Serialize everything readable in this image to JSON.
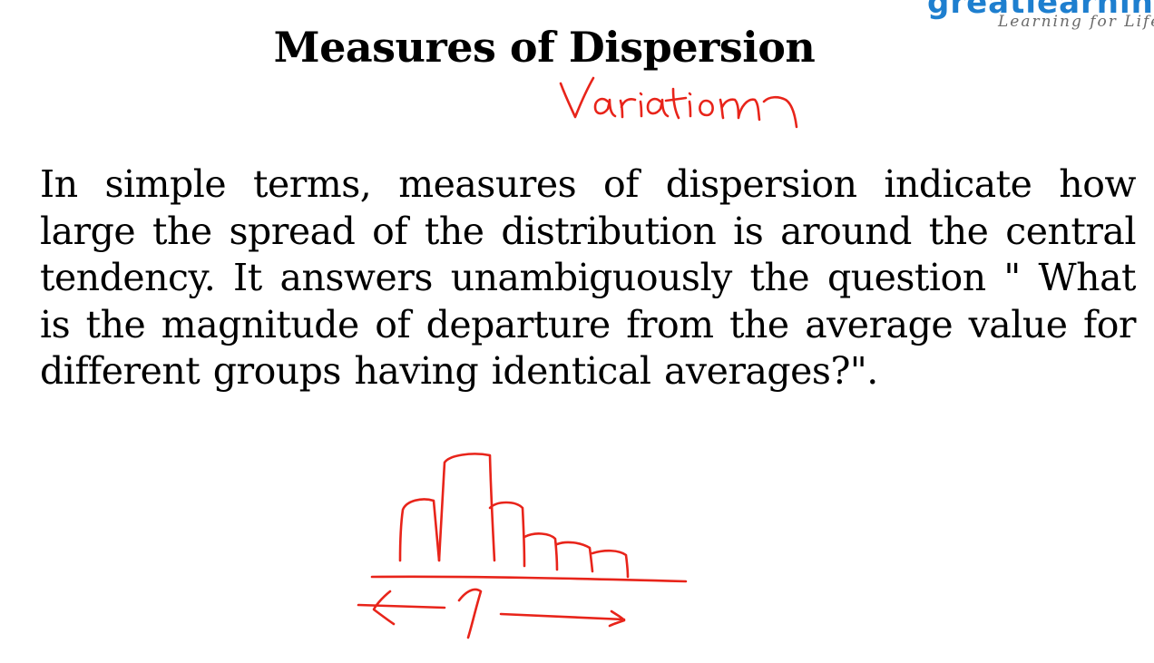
{
  "logo": {
    "brand": "greatlearning",
    "tagline": "Learning for Life"
  },
  "slide": {
    "title": "Measures of Dispersion",
    "body": "In simple terms, measures of dispersion indicate how large the spread of the distribution is around the central tendency. It answers unambiguously the question \" What is the magnitude of departure from the average value for different groups having identical averages?\"."
  },
  "annotation": {
    "handwritten_word": "Variation",
    "ink_color": "#e8241a"
  }
}
